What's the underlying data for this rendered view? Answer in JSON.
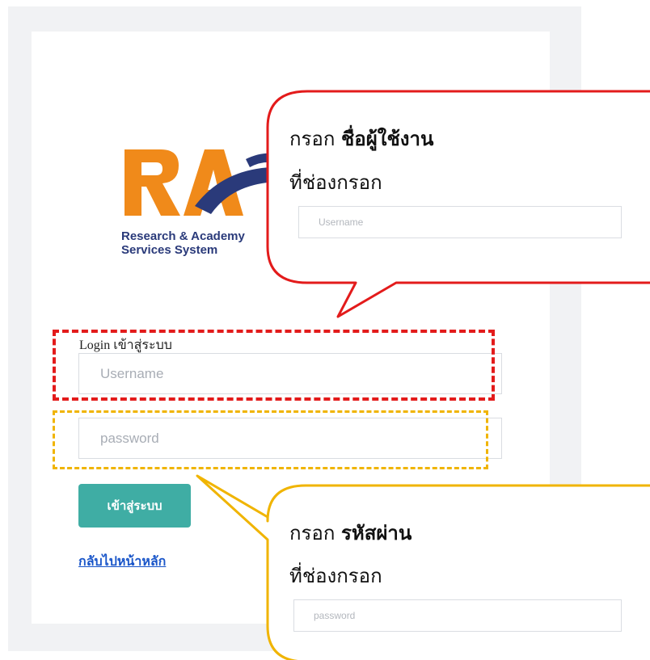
{
  "logo": {
    "mark_text": "RASS",
    "subtitle_line1": "Research & Academy",
    "subtitle_line2": "Services System",
    "colors": {
      "orange": "#f08a1a",
      "navy": "#2a3a7a"
    }
  },
  "login_form": {
    "label": "Login เข้าสู่ระบบ",
    "username_placeholder": "Username",
    "password_placeholder": "password",
    "submit_label": "เข้าสู่ระบบ",
    "back_link": "กลับไปหน้าหลัก"
  },
  "callout_username": {
    "prefix": "กรอก ",
    "emphasis": "ชื่อผู้ใช้งาน",
    "line2": "ที่ช่องกรอก",
    "example_placeholder": "Username",
    "color": "#e31b1b"
  },
  "callout_password": {
    "prefix": "กรอก ",
    "emphasis": "รหัสผ่าน",
    "line2": "ที่ช่องกรอก",
    "example_placeholder": "password",
    "color": "#f0b400"
  },
  "theme": {
    "button_color": "#3fada4",
    "link_color": "#1a56c9"
  }
}
